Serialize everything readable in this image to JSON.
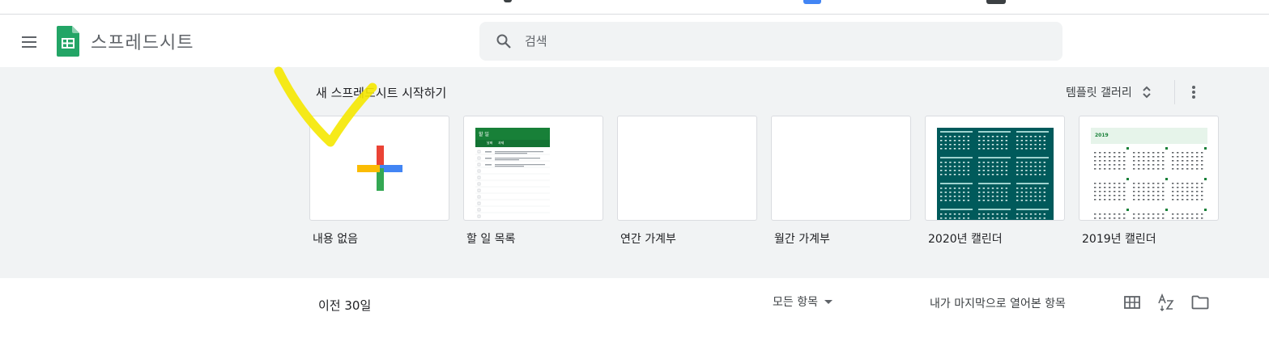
{
  "colors": {
    "sheets_green": "#23a566",
    "sheets_dark_green": "#188038",
    "calendar_teal": "#005a5b",
    "plus_red": "#ea4335",
    "plus_blue": "#4285f4",
    "plus_yellow": "#fbbc04",
    "plus_green": "#34a853",
    "highlight_yellow": "#f5e800"
  },
  "header": {
    "app_title": "스프레드시트",
    "menu_icon": "hamburger-menu-icon",
    "logo_icon": "google-sheets-logo-icon"
  },
  "search": {
    "placeholder": "검색",
    "icon": "search-icon"
  },
  "templates": {
    "heading": "새 스프레드시트 시작하기",
    "gallery_label": "템플릿 갤러리",
    "items": [
      {
        "label": "내용 없음",
        "kind": "blank"
      },
      {
        "label": "할 일 목록",
        "kind": "todo"
      },
      {
        "label": "연간 가계부",
        "kind": "budget-annual"
      },
      {
        "label": "월간 가계부",
        "kind": "budget-monthly"
      },
      {
        "label": "2020년 캘린더",
        "kind": "calendar-2020"
      },
      {
        "label": "2019년 캘린더",
        "kind": "calendar-2019"
      }
    ],
    "todo_thumb": {
      "title": "할 일",
      "col_date": "날짜",
      "col_task": "과제"
    },
    "calendar_2019_thumb": {
      "year": "2019"
    }
  },
  "recent": {
    "title": "이전 30일",
    "owner_filter": "모든 항목",
    "sort_label": "내가 마지막으로 열어본 항목",
    "view_icons": [
      "grid-view-icon",
      "sort-az-icon",
      "folder-icon"
    ]
  }
}
